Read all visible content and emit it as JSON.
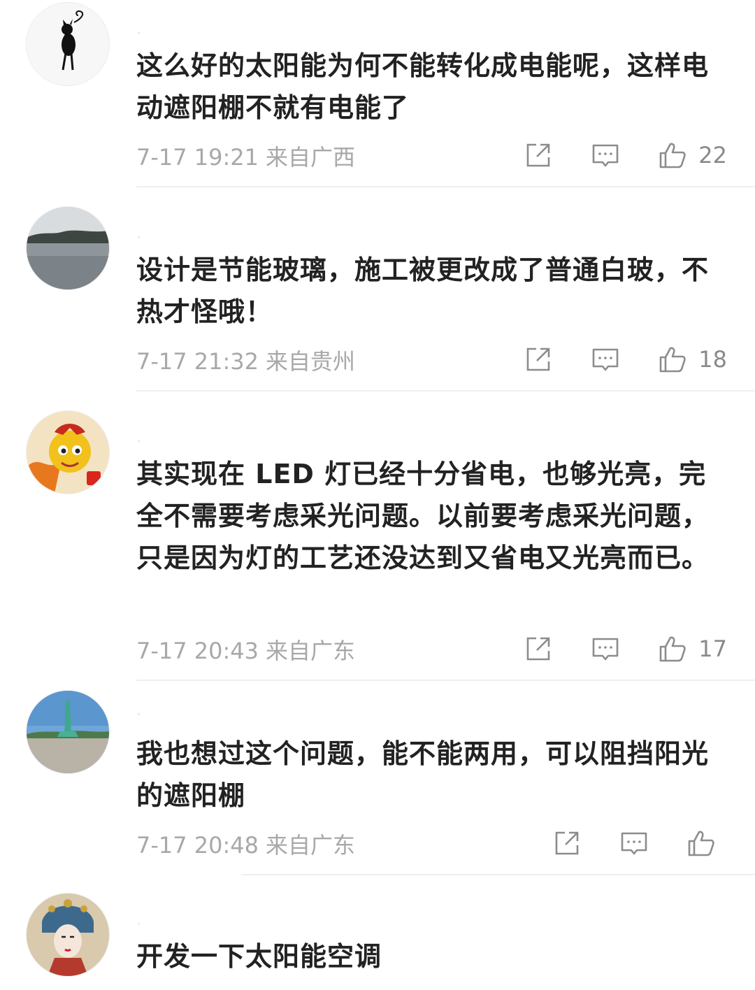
{
  "comments": [
    {
      "avatar": "cat-figure-avatar",
      "content": "这么好的太阳能为何不能转化成电能呢，这样电动遮阳棚不就有电能了",
      "time": "7-17 19:21",
      "location": "来自广西",
      "likes": "22"
    },
    {
      "avatar": "lake-landscape-avatar",
      "content": "设计是节能玻璃，施工被更改成了普通白玻，不热才怪哦！",
      "time": "7-17 21:32",
      "location": "来自贵州",
      "likes": "18"
    },
    {
      "avatar": "cartoon-dragon-avatar",
      "content": "其实现在 LED 灯已经十分省电，也够光亮，完全不需要考虑采光问题。以前要考虑采光问题，只是因为灯的工艺还没达到又省电又光亮而已。",
      "time": "7-17 20:43",
      "location": "来自广东",
      "likes": "17"
    },
    {
      "avatar": "monument-plaza-avatar",
      "content": "我也想过这个问题，能不能两用，可以阻挡阳光的遮阳棚",
      "time": "7-17 20:48",
      "location": "来自广东",
      "likes": ""
    },
    {
      "avatar": "opera-queen-avatar",
      "content": "开发一下太阳能空调",
      "time": "",
      "location": "",
      "likes": ""
    }
  ],
  "icons": {
    "share": "share-icon",
    "reply": "comment-icon",
    "like": "thumbs-up-icon"
  },
  "colors": {
    "text": "#222222",
    "meta": "#a8a8a8",
    "icon": "#8c8c8c",
    "divider": "#efefef"
  }
}
